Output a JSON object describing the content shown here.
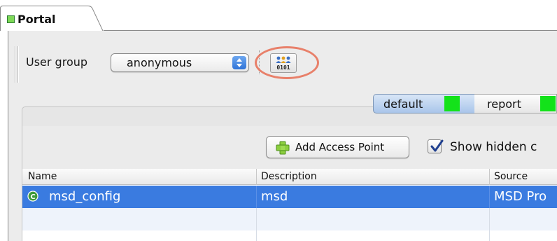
{
  "tab": {
    "label": "Portal",
    "icon": "green-square-icon"
  },
  "toolbar": {
    "user_group_label": "User group",
    "user_group_value": "anonymous",
    "group_button_icon": "user-group-binary-icon",
    "highlight_color": "#e8806a"
  },
  "views": [
    {
      "label": "default",
      "selected": true,
      "swatch_color": "#13e21a"
    },
    {
      "label": "report",
      "selected": false,
      "swatch_color": "#13e21a"
    }
  ],
  "actions": {
    "add_access_point_label": "Add Access Point",
    "show_hidden_label": "Show hidden c",
    "show_hidden_checked": true
  },
  "table": {
    "columns": [
      "Name",
      "Description",
      "Source"
    ],
    "rows": [
      {
        "name": "msd_config",
        "description": "msd",
        "source": "MSD Pro",
        "icon": "class-c-icon",
        "selected": true
      }
    ]
  },
  "colors": {
    "selection": "#3a7be0",
    "segment_selected": "#a9c5ea"
  }
}
